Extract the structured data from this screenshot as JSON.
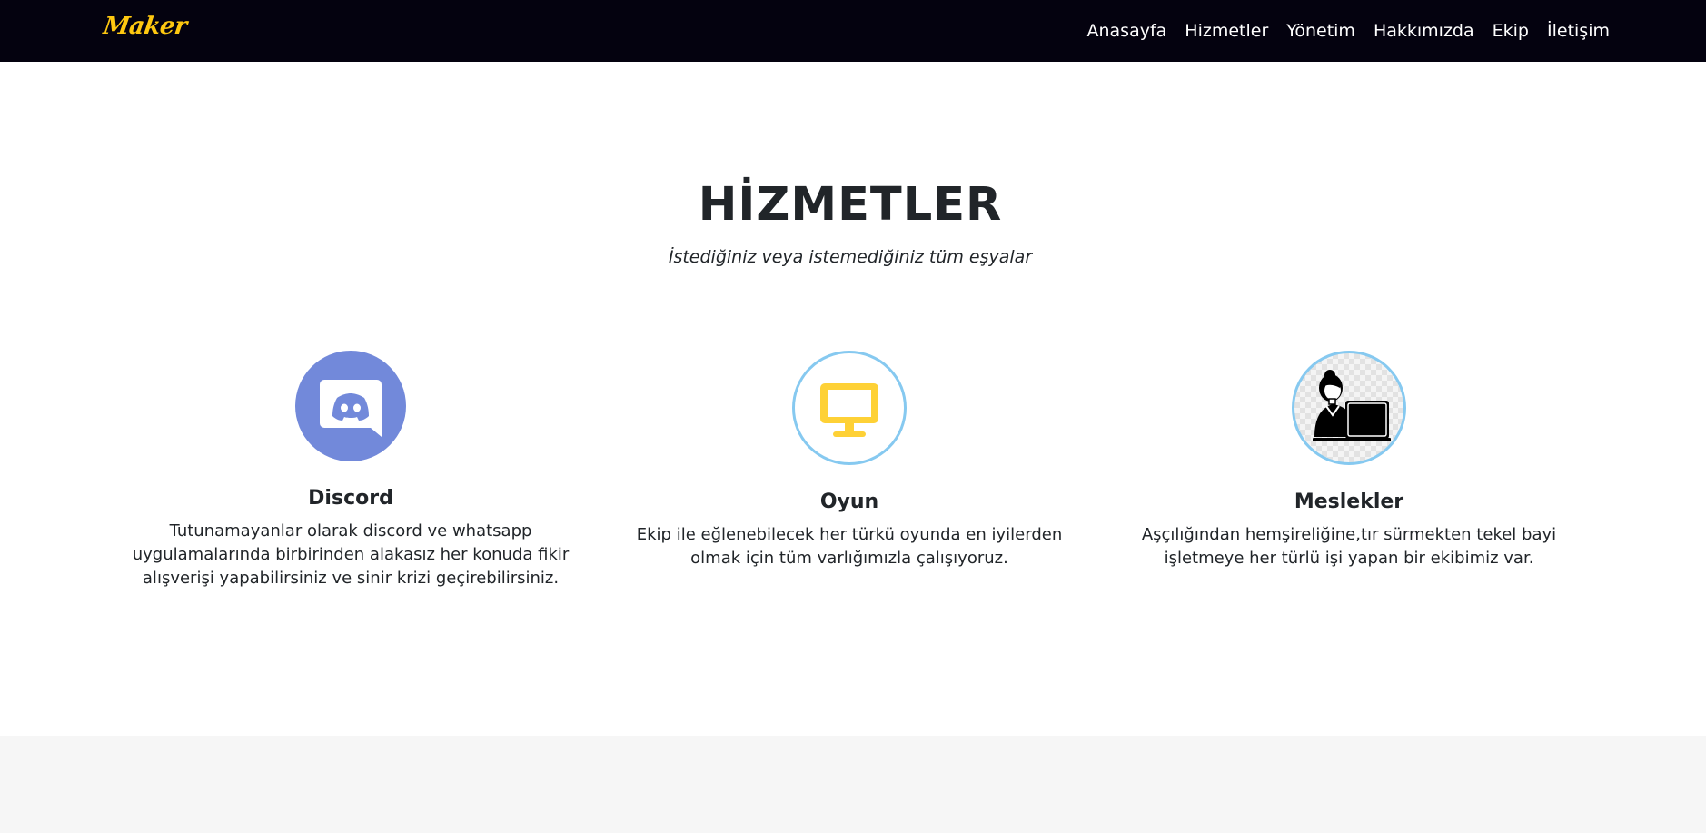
{
  "navbar": {
    "brand": "Maker",
    "links": [
      "Anasayfa",
      "Hizmetler",
      "Yönetim",
      "Hakkımızda",
      "Ekip",
      "İletişim"
    ]
  },
  "services": {
    "heading": "HİZMETLER",
    "subheading": "İstediğiniz veya istemediğiniz tüm eşyalar",
    "items": [
      {
        "title": "Discord",
        "description": "Tutunamayanlar olarak discord ve whatsapp uygulamalarında birbirinden alakasız her konuda fikir alışverişi yapabilirsiniz ve sinir krizi geçirebilirsiniz.",
        "icon": "discord-icon"
      },
      {
        "title": "Oyun",
        "description": "Ekip ile eğlenebilecek her türkü oyunda en iyilerden olmak için tüm varlığımızla çalışıyoruz.",
        "icon": "monitor-icon"
      },
      {
        "title": "Meslekler",
        "description": "Aşçılığından hemşireliğine,tır sürmekten tekel bayi işletmeye her türlü işi yapan bir ekibimiz var.",
        "icon": "person-laptop-icon"
      }
    ]
  },
  "colors": {
    "navbar_bg": "#04020f",
    "brand": "#fec810",
    "discord": "#7289da",
    "monitor": "#fed136",
    "ring": "#86c9f0",
    "bottom_section_bg": "#f6f6f6"
  }
}
